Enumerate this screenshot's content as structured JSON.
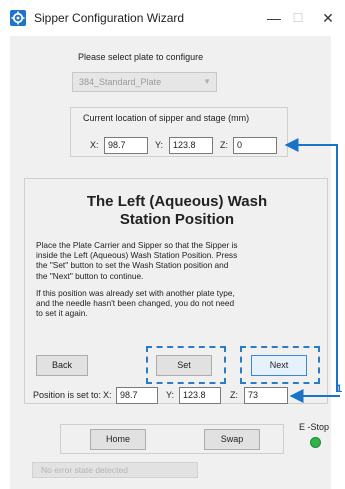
{
  "window": {
    "title": "Sipper Configuration Wizard",
    "minimize_glyph": "—",
    "maximize_glyph": "☐",
    "close_glyph": "✕"
  },
  "plate": {
    "prompt": "Please select plate to configure",
    "selected": "384_Standard_Plate"
  },
  "current_location": {
    "label": "Current location of sipper and stage (mm)",
    "x_label": "X:",
    "x": "98.7",
    "y_label": "Y:",
    "y": "123.8",
    "z_label": "Z:",
    "z": "0"
  },
  "step": {
    "title_line1": "The Left (Aqueous) Wash",
    "title_line2": "Station Position",
    "instructions": [
      "Place the Plate Carrier and Sipper so that the Sipper is",
      "inside the Left (Aqueous) Wash Station Position. Press",
      "the \"Set\" button to set the Wash Station position and",
      "the \"Next\" button to continue."
    ],
    "note": [
      "If this position was already set with another plate type,",
      "and the needle hasn't been changed, you do not need",
      "to set it again."
    ]
  },
  "buttons": {
    "back": "Back",
    "set": "Set",
    "next": "Next",
    "home": "Home",
    "swap": "Swap"
  },
  "position_set": {
    "label": "Position is set to:",
    "x_label": "X:",
    "x": "98.7",
    "y_label": "Y:",
    "y": "123.8",
    "z_label": "Z:",
    "z": "73"
  },
  "estop": {
    "label": "E -Stop"
  },
  "status": {
    "text": "No error state detected"
  },
  "annotation": {
    "callout_number": "1",
    "color": "#1a73c8"
  }
}
